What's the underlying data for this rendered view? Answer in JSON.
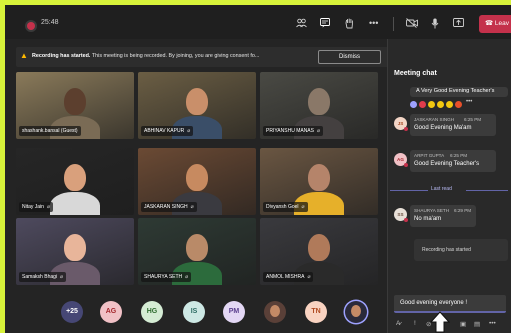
{
  "recording": {
    "time": "25:48"
  },
  "toolbar": {
    "icons": [
      "people-icon",
      "chat-icon",
      "raise-hand-icon",
      "more-icon",
      "camera-off-icon",
      "mic-icon",
      "share-icon"
    ],
    "leave_label": "Leav"
  },
  "banner": {
    "title": "Recording has started.",
    "body": "This meeting is being recorded. By joining, you are giving consent fo...",
    "dismiss_label": "Dismiss"
  },
  "tiles": [
    {
      "name": "shashank.bansal (Guest)",
      "mic": false,
      "bg": "#8a7a5a",
      "skin": "#5c3f2e",
      "shirt": "#7a6b55"
    },
    {
      "name": "ABHINAV KAPUR",
      "mic": true,
      "bg": "#6b5e44",
      "skin": "#c98f6a",
      "shirt": "#3a4e68"
    },
    {
      "name": "PRIYANSHU MANAS",
      "mic": true,
      "bg": "#4a4a44",
      "skin": "#8a7868",
      "shirt": "#444040"
    },
    {
      "name": "Nitay Jain",
      "mic": true,
      "bg": "#262626",
      "skin": "#d9a07c",
      "shirt": "#d8d8d8"
    },
    {
      "name": "JASKARAN SINGH",
      "mic": true,
      "bg": "#6b4a34",
      "skin": "#c78a60",
      "shirt": "#3a3a40"
    },
    {
      "name": "Divyansh Goel",
      "mic": true,
      "bg": "#6a5642",
      "skin": "#b5846a",
      "shirt": "#e6b02a"
    },
    {
      "name": "Samaksh Bhagi",
      "mic": true,
      "bg": "#4e4a5e",
      "skin": "#e8b59a",
      "shirt": "#6a5a6a"
    },
    {
      "name": "SHAURYA SETH",
      "mic": true,
      "bg": "#2e3a34",
      "skin": "#b98a68",
      "shirt": "#2c6b3c"
    },
    {
      "name": "ANMOL MISHRA",
      "mic": true,
      "bg": "#3a3a3e",
      "skin": "#b07a5a",
      "shirt": "#2a2a2a"
    }
  ],
  "participants": [
    {
      "label": "+25",
      "bg": "#464775",
      "fg": "#ffffff"
    },
    {
      "label": "AG",
      "bg": "#f1c1c6",
      "fg": "#a4262c"
    },
    {
      "label": "HG",
      "bg": "#d5ecd4",
      "fg": "#2e6b2e"
    },
    {
      "label": "IS",
      "bg": "#cde8e4",
      "fg": "#2c6b63"
    },
    {
      "label": "PM",
      "bg": "#e3d7f4",
      "fg": "#5b3f8e"
    },
    {
      "label": "",
      "bg": "#5a4038",
      "fg": "#ffffff"
    },
    {
      "label": "TN",
      "bg": "#f9d3c1",
      "fg": "#b04a20"
    },
    {
      "label": "",
      "bg": "#2a2a3a",
      "fg": "#ffffff"
    }
  ],
  "chat": {
    "title": "Meeting chat",
    "first_message": "A Very Good Evening Teacher's",
    "messages": [
      {
        "initials": "JS",
        "chip_bg": "#f3d5c6",
        "chip_fg": "#a3441d",
        "name": "JASKARAN SINGH",
        "time": "6:25 PM",
        "text": "Good Evening Ma'am"
      },
      {
        "initials": "AG",
        "chip_bg": "#f1c1c6",
        "chip_fg": "#a4262c",
        "name": "ARPIT GUPTA",
        "time": "6:25 PM",
        "text": "Good Evening Teacher's"
      },
      {
        "initials": "SS",
        "chip_bg": "#e8e0d8",
        "chip_fg": "#6a5040",
        "name": "SHAURYA SETH",
        "time": "6:29 PM",
        "text": "No ma'am"
      }
    ],
    "last_read": "Last read",
    "system_message": "Recording has started",
    "compose_value": "Good evening everyone !"
  },
  "colors": {
    "accent": "#6264a7",
    "leave": "#c4314b",
    "warning": "#ffb900",
    "page_bg": "#d7f23a"
  }
}
